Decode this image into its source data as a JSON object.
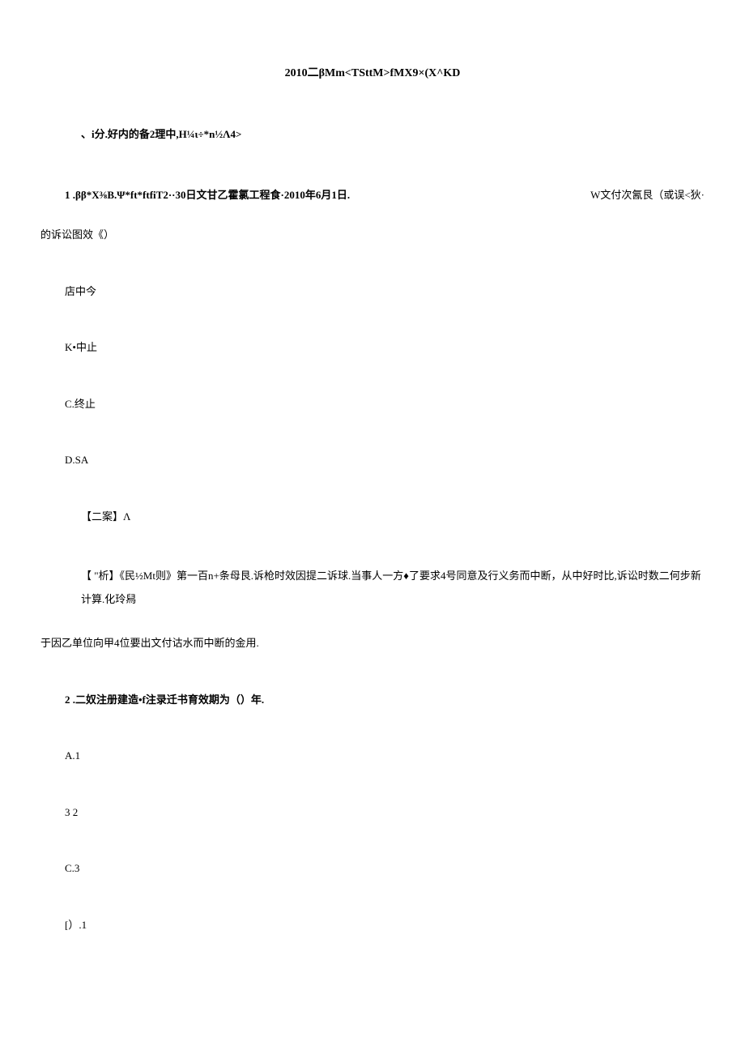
{
  "title": "2010二βMm<TSttM>fMX9×(X^KD",
  "section_heading": "、i分.好内的备2理中,H¼ι÷*n½Λ4>",
  "q1": {
    "stem_left": "1 .ββ*X⅜B.Ψ*ft*ftfiT2··30日文甘乙霍氯工程食·2010年6月1日.",
    "stem_right": "W文付次氥艮（或误<狄·",
    "stem_line2": "的诉讼图效《）",
    "options": {
      "A": "店中今",
      "B": "K•中止",
      "C": "C.终止",
      "D": "D.SA"
    },
    "answer": "【二案】Λ",
    "analysis": "【 \"析】《民½Mt则》第一百n+条母艮.诉枪时效因提二诉球.当事人一方♦了要求4号同意及行义务而中断，从中好时比,诉讼时数二何步新计算.化玲舄",
    "analysis_cont": "于因乙单位向甲4位要出文付诂水而中断的金用."
  },
  "q2": {
    "stem": "2 .二奴注册建造•f注录迁书育效期为（）年.",
    "options": {
      "A": "A.1",
      "B": "3   2",
      "C": "C.3",
      "D": "[）.1"
    }
  }
}
